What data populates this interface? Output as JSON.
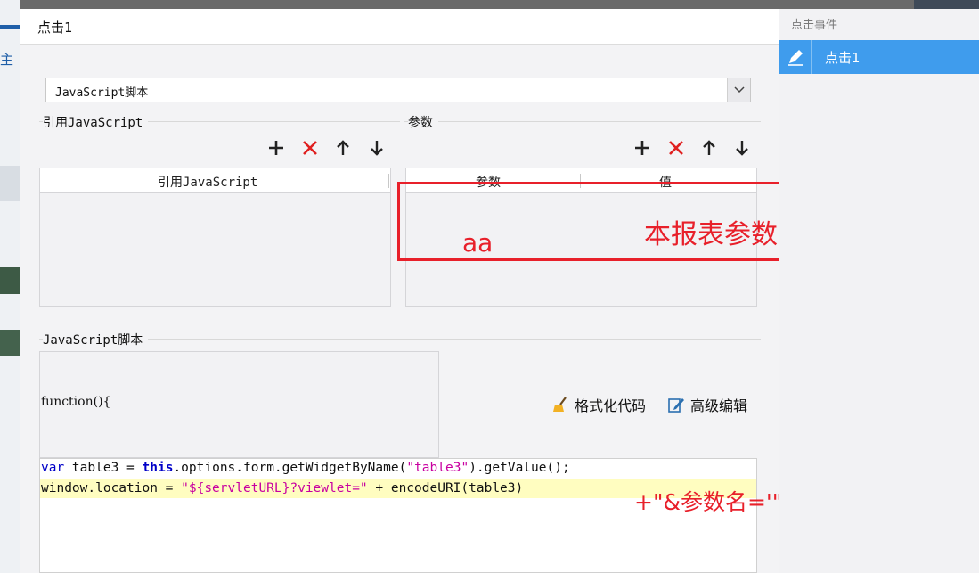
{
  "dialog": {
    "title": "点击1",
    "script_type_select": {
      "value": "JavaScript脚本"
    },
    "ref_js_group": {
      "label": "引用JavaScript",
      "table_header": "引用JavaScript"
    },
    "params_group": {
      "label": "参数",
      "columns": [
        "参数",
        "值"
      ]
    },
    "script_group": {
      "label": "JavaScript脚本",
      "function_signature": "function(){",
      "format_code_label": "格式化代码",
      "advanced_edit_label": "高级编辑"
    },
    "code": {
      "line1": {
        "t1": "var",
        "t2": " table3 = ",
        "t3": "this",
        "t4": ".options.form.getWidgetByName(",
        "t5": "\"table3\"",
        "t6": ").getValue();"
      },
      "line2": {
        "t1": "window.location = ",
        "t2": "\"${servletURL}?viewlet=\"",
        "t3": " + encodeURI(table3)"
      }
    }
  },
  "annotations": {
    "report_param_value": "本报表参数值",
    "aa": "aa",
    "concat": "+\"&参数名='\"+aa+\"'\""
  },
  "side_panel": {
    "title": "点击事件",
    "items": [
      {
        "label": "点击1"
      }
    ]
  },
  "background": {
    "glyph": "主"
  },
  "colors": {
    "accent": "#3f9ced",
    "annotation": "#e8202a",
    "code_keyword": "#0000c8",
    "code_string": "#c800a0",
    "code_highlight": "#fffdc0"
  }
}
